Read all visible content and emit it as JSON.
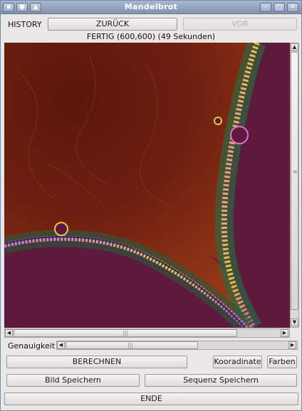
{
  "window": {
    "title": "Mandelbrot",
    "controls": {
      "menu_icon": "menu-icon",
      "sticky_icon": "pin-icon",
      "shade_icon": "up-arrow-icon",
      "minimize_icon": "minimize-icon",
      "maximize_icon": "maximize-icon",
      "close_icon": "close-icon"
    }
  },
  "history": {
    "label": "HISTORY",
    "back_label": "ZURÜCK",
    "forward_label": "VOR",
    "forward_enabled": false
  },
  "status": {
    "text": "FERTIG (600,600) (49 Sekunden)"
  },
  "canvas": {
    "name": "mandelbrot-render",
    "colors": {
      "set": "#5e1a3c",
      "outer_dark": "#6b1a0f",
      "outer_mid": "#8a2a14",
      "edge_gold": "#e0c040",
      "edge_pink": "#e070d0",
      "edge_green": "#2a6a40",
      "edge_blue": "#202a70"
    }
  },
  "precision": {
    "label": "Genauigkeit"
  },
  "actions": {
    "compute_label": "BERECHNEN",
    "coordinates_label": "Kooradinate",
    "colors_label": "Farben",
    "save_image_label": "Bild Speichern",
    "save_sequence_label": "Sequenz Speichern",
    "exit_label": "ENDE"
  }
}
